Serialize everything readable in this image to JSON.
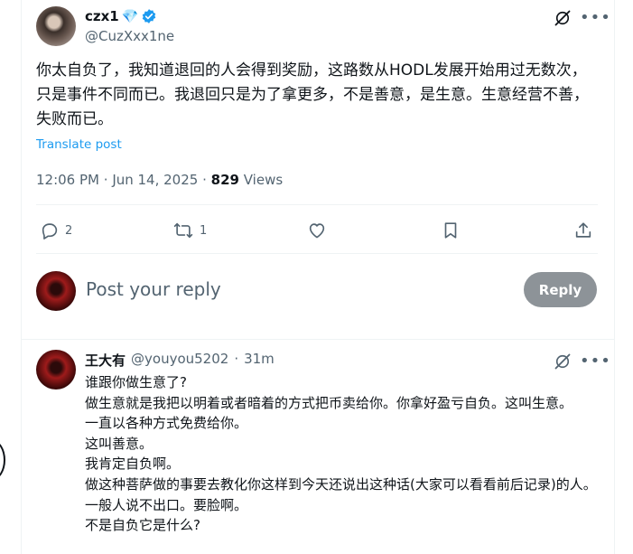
{
  "post": {
    "author_name": "czx1",
    "author_emoji": "💎",
    "author_handle": "@CuzXxx1ne",
    "text": "你太自负了，我知道退回的人会得到奖励，这路数从HODL发展开始用过无数次，只是事件不同而已。我退回只是为了拿更多，不是善意，是生意。生意经营不善，失败而已。",
    "translate_label": "Translate post",
    "time": "12:06 PM",
    "date": "Jun 14, 2025",
    "views_count": "829",
    "views_label": "Views"
  },
  "actions": {
    "reply_count": "2",
    "repost_count": "1"
  },
  "reply_box": {
    "placeholder": "Post your reply",
    "button_label": "Reply"
  },
  "comment": {
    "author_name": "王大有",
    "author_handle": "@youyou5202",
    "time": "31m",
    "lines": [
      "谁跟你做生意了?",
      "做生意就是我把以明着或者暗着的方式把币卖给你。你拿好盈亏自负。这叫生意。",
      "一直以各种方式免费给你。",
      "这叫善意。",
      "我肯定自负啊。",
      "做这种菩萨做的事要去教化你这样到今天还说出这种话(大家可以看看前后记录)的人。一般人说不出口。要脸啊。",
      "不是自负它是什么?"
    ]
  },
  "colors": {
    "accent": "#1d9bf0",
    "secondary_text": "#536471",
    "primary_text": "#0f1419",
    "reply_button_bg": "#8d9398"
  },
  "icons": [
    "verified-badge-icon",
    "grok-icon",
    "more-icon",
    "reply-icon",
    "repost-icon",
    "like-icon",
    "bookmark-icon",
    "share-icon"
  ]
}
